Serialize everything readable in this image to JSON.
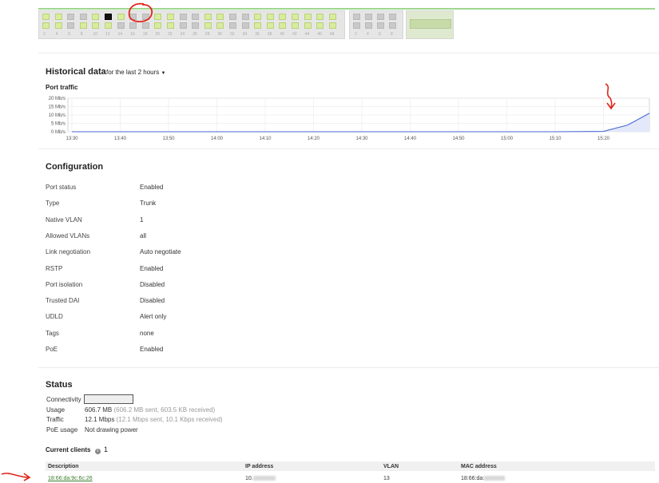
{
  "switch": {
    "port_numbers": [
      "2",
      "4",
      "6",
      "8",
      "10",
      "12",
      "14",
      "16",
      "18",
      "20",
      "22",
      "24",
      "26",
      "28",
      "30",
      "32",
      "34",
      "36",
      "38",
      "40",
      "42",
      "44",
      "46",
      "48"
    ],
    "sfp_numbers": [
      "2",
      "4",
      "6",
      "8"
    ],
    "active_port": "12"
  },
  "historical": {
    "title": "Historical data",
    "range_label": "for the last 2 hours",
    "chart_title": "Port traffic"
  },
  "chart_data": {
    "type": "line",
    "title": "Port traffic",
    "y_ticks": [
      "20 Mb/s",
      "15 Mb/s",
      "10 Mb/s",
      "5 Mb/s",
      "0 Mb/s"
    ],
    "ylim": [
      0,
      20
    ],
    "x_ticks": [
      "13:30",
      "13:40",
      "13:50",
      "14:00",
      "14:10",
      "14:20",
      "14:30",
      "14:40",
      "14:50",
      "15:00",
      "15:10",
      "15:20"
    ],
    "series": [
      {
        "x": [
          "13:30",
          "13:40",
          "13:50",
          "14:00",
          "14:10",
          "14:20",
          "14:30",
          "14:40",
          "14:50",
          "15:00",
          "15:10",
          "15:20",
          "15:25",
          "15:30"
        ],
        "values": [
          0,
          0,
          0,
          0,
          0,
          0,
          0,
          0,
          0,
          0,
          0,
          0.2,
          4,
          11
        ]
      }
    ],
    "grid": true,
    "line_color": "#4a67d6",
    "fill_color": "#e3e8fb"
  },
  "configuration": {
    "title": "Configuration",
    "rows": [
      {
        "label": "Port status",
        "value": "Enabled"
      },
      {
        "label": "Type",
        "value": "Trunk"
      },
      {
        "label": "Native VLAN",
        "value": "1"
      },
      {
        "label": "Allowed VLANs",
        "value": "all"
      },
      {
        "label": "Link negotiation",
        "value": "Auto negotiate"
      },
      {
        "label": "RSTP",
        "value": "Enabled"
      },
      {
        "label": "Port isolation",
        "value": "Disabled"
      },
      {
        "label": "Trusted DAI",
        "value": "Disabled"
      },
      {
        "label": "UDLD",
        "value": "Alert only"
      },
      {
        "label": "Tags",
        "value": "none"
      },
      {
        "label": "PoE",
        "value": "Enabled"
      }
    ]
  },
  "status": {
    "title": "Status",
    "connectivity_label": "Connectivity",
    "usage_label": "Usage",
    "usage_value": "606.7 MB",
    "usage_detail": "(606.2 MB sent, 603.5 KB received)",
    "traffic_label": "Traffic",
    "traffic_value": "12.1 Mbps",
    "traffic_detail": "(12.1 Mbps sent, 10.1 Kbps received)",
    "poe_label": "PoE usage",
    "poe_value": "Not drawing power"
  },
  "clients": {
    "title": "Current clients",
    "info_icon": "info-icon",
    "count": "1",
    "headers": [
      "Description",
      "IP address",
      "VLAN",
      "MAC address"
    ],
    "rows": [
      {
        "description": "18:66:da:9c:6c:26",
        "ip": "10.",
        "vlan": "13",
        "mac": "18:66:da:"
      }
    ]
  },
  "annotations": {
    "color": "#e0261b"
  }
}
